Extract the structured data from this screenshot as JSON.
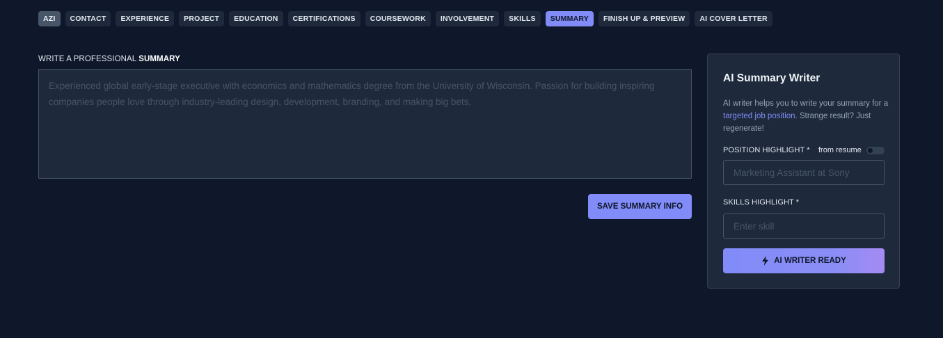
{
  "nav": {
    "tabs": [
      {
        "label": "AZI",
        "state": "first"
      },
      {
        "label": "CONTACT"
      },
      {
        "label": "EXPERIENCE"
      },
      {
        "label": "PROJECT"
      },
      {
        "label": "EDUCATION"
      },
      {
        "label": "CERTIFICATIONS"
      },
      {
        "label": "COURSEWORK"
      },
      {
        "label": "INVOLVEMENT"
      },
      {
        "label": "SKILLS"
      },
      {
        "label": "SUMMARY",
        "state": "active"
      },
      {
        "label": "FINISH UP & PREVIEW"
      },
      {
        "label": "AI COVER LETTER"
      }
    ]
  },
  "summary": {
    "label_prefix": "WRITE A PROFESSIONAL",
    "label_emphasis": "SUMMARY",
    "value": "",
    "placeholder": "Experienced global early-stage executive with economics and mathematics degree from the University of Wisconsin. Passion for building inspiring companies people love through industry-leading design, development, branding, and making big bets.",
    "save_label": "SAVE SUMMARY INFO"
  },
  "ai_panel": {
    "title": "AI Summary Writer",
    "desc_before": "AI writer helps you to write your summary for a ",
    "desc_link": "targeted job position",
    "desc_after": ". Strange result? Just regenerate!",
    "position_label": "POSITION HIGHLIGHT *",
    "from_resume_label": "from resume",
    "from_resume_on": false,
    "position_value": "",
    "position_placeholder": "Marketing Assistant at Sony",
    "skills_label": "SKILLS HIGHLIGHT *",
    "skills_value": "",
    "skills_placeholder": "Enter skill",
    "button_label": "AI WRITER READY",
    "button_icon": "bolt-icon"
  },
  "colors": {
    "background": "#0f172a",
    "surface": "#1e293b",
    "accent": "#818cf8",
    "muted_text": "#94a3b8"
  }
}
